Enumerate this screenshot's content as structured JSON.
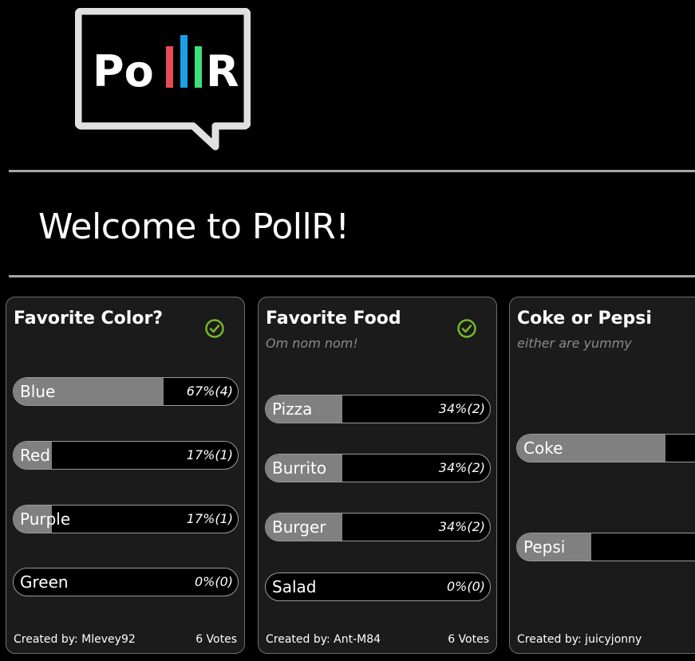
{
  "logo": {
    "letters_white": "Po",
    "letter_r": "R"
  },
  "welcome": "Welcome to PollR!",
  "colors": {
    "bar_red": "#e74b57",
    "bar_blue": "#1aa0e6",
    "bar_green": "#3de07a",
    "check": "#75b82a",
    "fill": "#808080"
  },
  "polls": [
    {
      "title": "Favorite Color?",
      "subtitle": "",
      "voted": true,
      "options": [
        {
          "label": "Blue",
          "value": "67%(4)",
          "percent": 67
        },
        {
          "label": "Red",
          "value": "17%(1)",
          "percent": 17
        },
        {
          "label": "Purple",
          "value": "17%(1)",
          "percent": 17
        },
        {
          "label": "Green",
          "value": "0%(0)",
          "percent": 0
        }
      ],
      "creator": "Created by: Mlevey92",
      "votes": "6 Votes"
    },
    {
      "title": "Favorite Food",
      "subtitle": "Om nom nom!",
      "voted": true,
      "options": [
        {
          "label": "Pizza",
          "value": "34%(2)",
          "percent": 34
        },
        {
          "label": "Burrito",
          "value": "34%(2)",
          "percent": 34
        },
        {
          "label": "Burger",
          "value": "34%(2)",
          "percent": 34
        },
        {
          "label": "Salad",
          "value": "0%(0)",
          "percent": 0
        }
      ],
      "creator": "Created by: Ant-M84",
      "votes": "6 Votes"
    },
    {
      "title": "Coke or Pepsi",
      "subtitle": "either are yummy",
      "voted": false,
      "options": [
        {
          "label": "Coke",
          "value": "",
          "percent": 72
        },
        {
          "label": "Pepsi",
          "value": "",
          "percent": 36
        }
      ],
      "creator": "Created by: juicyjonny",
      "votes": ""
    }
  ]
}
